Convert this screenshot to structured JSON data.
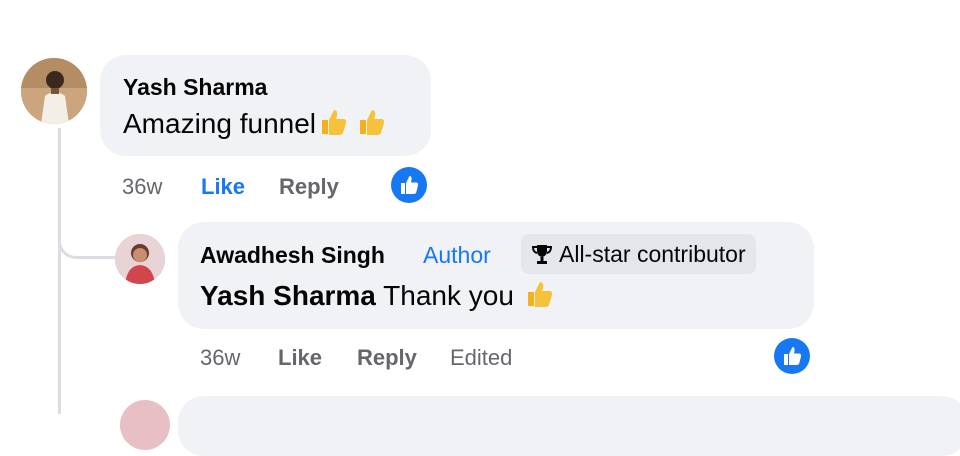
{
  "comment": {
    "author": "Yash Sharma",
    "text": "Amazing funnel",
    "time": "36w",
    "like_label": "Like",
    "reply_label": "Reply"
  },
  "reply": {
    "author": "Awadhesh Singh",
    "author_badge": "Author",
    "contributor_badge": "All-star contributor",
    "mention": "Yash Sharma",
    "text": "Thank you",
    "time": "36w",
    "like_label": "Like",
    "reply_label": "Reply",
    "edited_label": "Edited"
  },
  "colors": {
    "accent": "#1877f2",
    "bubble": "#f0f2f5",
    "meta_text": "#65676b",
    "badge_bg": "#e4e6eb",
    "emoji": "#f5b021"
  },
  "icons": [
    "thumbs-up-emoji",
    "trophy-icon",
    "like-reaction-icon",
    "avatar"
  ]
}
